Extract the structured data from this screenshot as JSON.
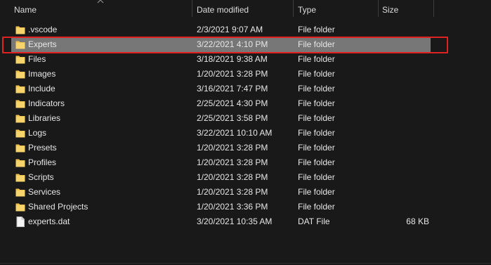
{
  "columns": {
    "name": "Name",
    "date_modified": "Date modified",
    "type": "Type",
    "size": "Size"
  },
  "icons": {
    "folder": "folder-icon",
    "file": "file-icon",
    "sort": "sort-up-icon"
  },
  "colors": {
    "background": "#191919",
    "selection": "#777777",
    "highlight": "#e02121",
    "folder": "#f0c14b"
  },
  "rows": [
    {
      "name": ".vscode",
      "date": "2/3/2021 9:07 AM",
      "type": "File folder",
      "size": "",
      "kind": "folder",
      "selected": false
    },
    {
      "name": "Experts",
      "date": "3/22/2021 4:10 PM",
      "type": "File folder",
      "size": "",
      "kind": "folder",
      "selected": true
    },
    {
      "name": "Files",
      "date": "3/18/2021 9:38 AM",
      "type": "File folder",
      "size": "",
      "kind": "folder",
      "selected": false
    },
    {
      "name": "Images",
      "date": "1/20/2021 3:28 PM",
      "type": "File folder",
      "size": "",
      "kind": "folder",
      "selected": false
    },
    {
      "name": "Include",
      "date": "3/16/2021 7:47 PM",
      "type": "File folder",
      "size": "",
      "kind": "folder",
      "selected": false
    },
    {
      "name": "Indicators",
      "date": "2/25/2021 4:30 PM",
      "type": "File folder",
      "size": "",
      "kind": "folder",
      "selected": false
    },
    {
      "name": "Libraries",
      "date": "2/25/2021 3:58 PM",
      "type": "File folder",
      "size": "",
      "kind": "folder",
      "selected": false
    },
    {
      "name": "Logs",
      "date": "3/22/2021 10:10 AM",
      "type": "File folder",
      "size": "",
      "kind": "folder",
      "selected": false
    },
    {
      "name": "Presets",
      "date": "1/20/2021 3:28 PM",
      "type": "File folder",
      "size": "",
      "kind": "folder",
      "selected": false
    },
    {
      "name": "Profiles",
      "date": "1/20/2021 3:28 PM",
      "type": "File folder",
      "size": "",
      "kind": "folder",
      "selected": false
    },
    {
      "name": "Scripts",
      "date": "1/20/2021 3:28 PM",
      "type": "File folder",
      "size": "",
      "kind": "folder",
      "selected": false
    },
    {
      "name": "Services",
      "date": "1/20/2021 3:28 PM",
      "type": "File folder",
      "size": "",
      "kind": "folder",
      "selected": false
    },
    {
      "name": "Shared Projects",
      "date": "1/20/2021 3:36 PM",
      "type": "File folder",
      "size": "",
      "kind": "folder",
      "selected": false
    },
    {
      "name": "experts.dat",
      "date": "3/20/2021 10:35 AM",
      "type": "DAT File",
      "size": "68 KB",
      "kind": "file",
      "selected": false
    }
  ]
}
